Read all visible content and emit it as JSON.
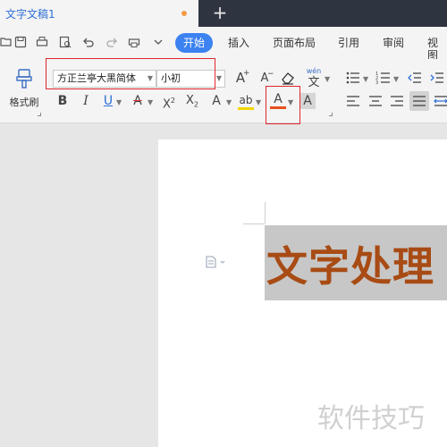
{
  "tab": {
    "title": "文字文稿1",
    "new_tab_symbol": "+"
  },
  "menu": {
    "tabs": [
      {
        "label": "开始",
        "active": true
      },
      {
        "label": "插入"
      },
      {
        "label": "页面布局"
      },
      {
        "label": "引用"
      },
      {
        "label": "审阅"
      },
      {
        "label": "视图"
      }
    ]
  },
  "quick_access": [
    "open-folder-icon",
    "save-icon",
    "print-icon",
    "print-preview-icon",
    "undo-icon",
    "redo-icon",
    "print-icon-2",
    "more-icon"
  ],
  "ribbon": {
    "format_painter_label": "格式刷",
    "font_family": "方正兰亭大黑简体",
    "font_size": "小初",
    "bold": "B",
    "italic": "I",
    "underline": "U",
    "strikethrough": "A",
    "superscript_base": "X",
    "superscript_mark": "2",
    "subscript_base": "X",
    "subscript_mark": "2",
    "font_grow": "A",
    "font_shrink": "A",
    "text_effect": "A",
    "highlight": "ab",
    "font_color": "A",
    "char_shading": "A",
    "phonetic_top": "wén",
    "phonetic_bottom": "文"
  },
  "document": {
    "text": "文字处理",
    "text_color": "#a84b14",
    "selection_color": "#c7c7c7"
  },
  "watermark": "软件技巧",
  "colors": {
    "accent": "#3c82f0",
    "annotation_red": "#e0262c",
    "font_color_bar": "#e6501c"
  }
}
